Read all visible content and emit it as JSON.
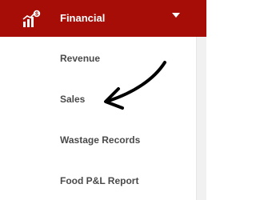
{
  "header": {
    "title": "Financial",
    "icon": "financial-chart-icon",
    "caret_icon": "caret-down-icon",
    "background": "#a50d06"
  },
  "menu": {
    "items": [
      {
        "label": "Revenue"
      },
      {
        "label": "Sales"
      },
      {
        "label": "Wastage Records"
      },
      {
        "label": "Food P&L Report"
      }
    ]
  },
  "annotation": {
    "icon": "arrow-pointer-icon",
    "color": "#000000"
  }
}
